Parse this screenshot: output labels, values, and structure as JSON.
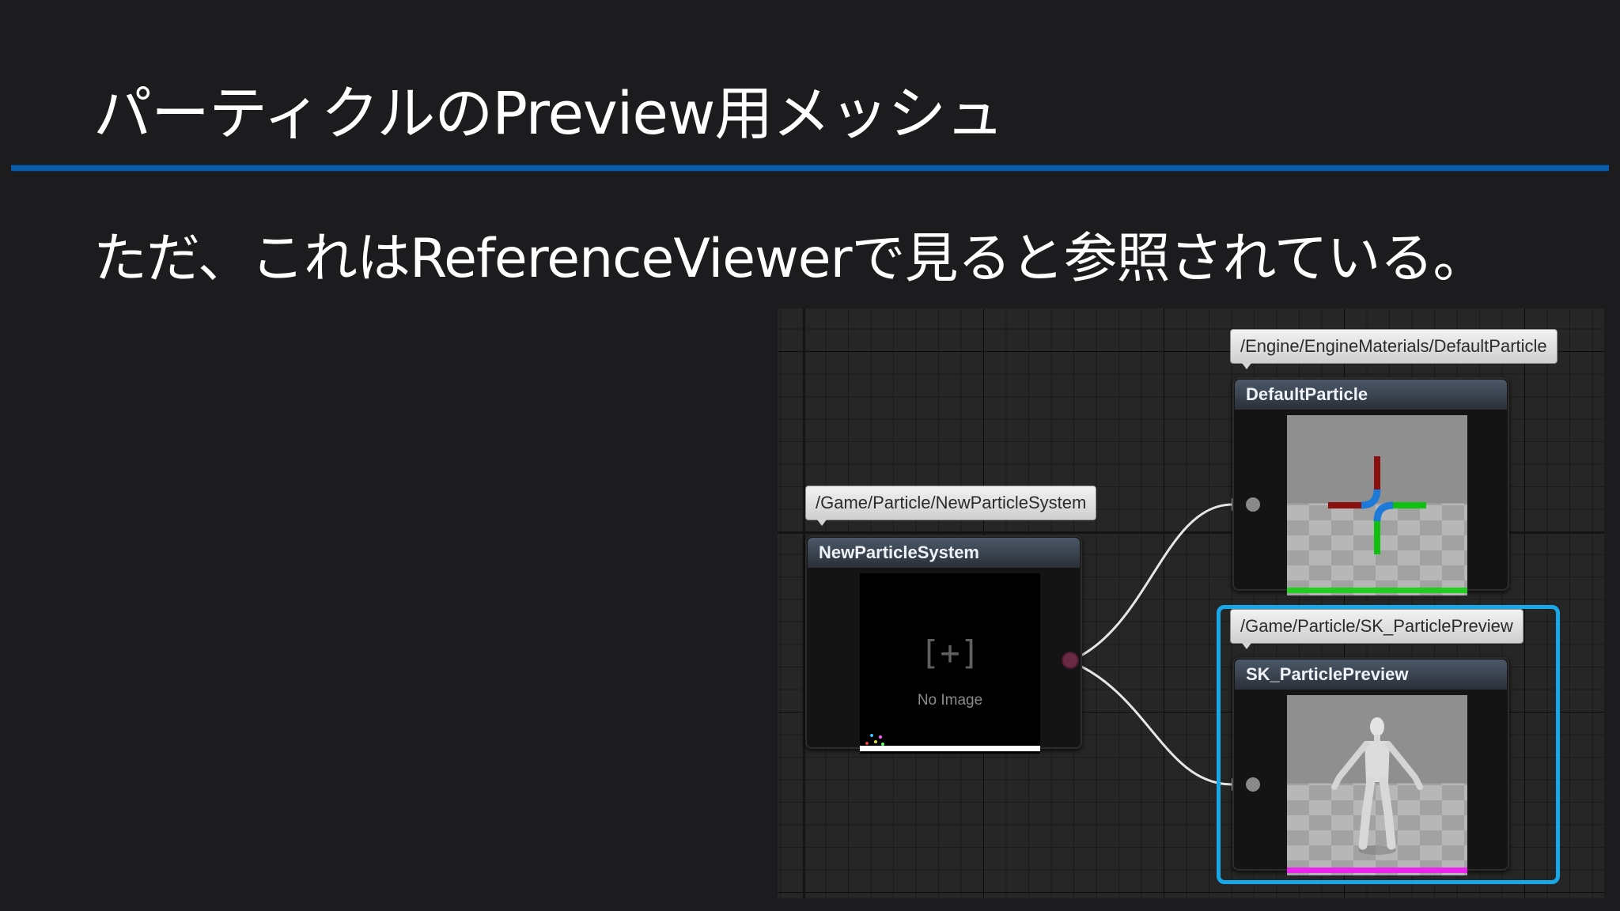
{
  "slide": {
    "title": "パーティクルのPreview用メッシュ",
    "body": "ただ、これはReferenceViewerで見ると参照されている。"
  },
  "reference_viewer": {
    "source_node": {
      "path": "/Game/Particle/NewParticleSystem",
      "name": "NewParticleSystem",
      "thumbnail_text": "No Image",
      "thumbnail_bracket": "[+]"
    },
    "dependency_nodes": [
      {
        "path": "/Engine/EngineMaterials/DefaultParticle",
        "name": "DefaultParticle",
        "type_color": "#22cc22",
        "selected": false
      },
      {
        "path": "/Game/Particle/SK_ParticlePreview",
        "name": "SK_ParticlePreview",
        "type_color": "#ee22ee",
        "selected": true
      }
    ],
    "colors": {
      "selection": "#18a8e8",
      "output_pin": "#6b2a44",
      "input_pin": "#8a8a8a",
      "wire": "#e6e6e6"
    }
  }
}
